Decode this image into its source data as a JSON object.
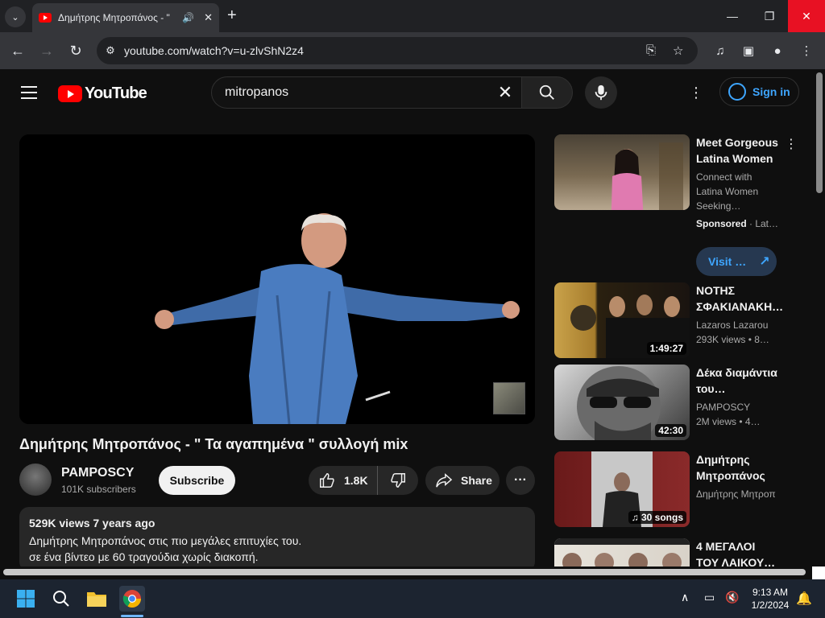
{
  "browser": {
    "tab_title": "Δημήτρης Μητροπάνος - \"",
    "url": "youtube.com/watch?v=u-zlvShN2z4"
  },
  "youtube": {
    "logo_text": "YouTube",
    "search_query": "mitropanos",
    "sign_in_label": "Sign in"
  },
  "video": {
    "title": "Δημήτρης Μητροπάνος - \" Τα αγαπημένα \" συλλογή mix",
    "channel_name": "PAMPOSCY",
    "subscribers": "101K subscribers",
    "subscribe_label": "Subscribe",
    "likes": "1.8K",
    "share_label": "Share",
    "views_and_date": "529K views  7 years ago",
    "description_lines": [
      "Δημήτρης Μητροπάνος στις πιο μεγάλες επιτυχίες του.",
      "σε ένα βίντεο με 60 τραγούδια  χωρίς διακοπή."
    ]
  },
  "sidebar": {
    "ad": {
      "title": "Meet Gorgeous Latina Women",
      "description": "Connect with Latina Women Seeking…",
      "sponsored": "Sponsored",
      "sponsored_suffix": " · Lat…",
      "visit_label": "Visit …"
    },
    "items": [
      {
        "title": "ΝΟΤΗΣ ΣΦΑΚΙΑΝΑΚΗ…",
        "channel": "Lazaros Lazarou",
        "meta": "293K views  • 8…",
        "duration": "1:49:27"
      },
      {
        "title": "Δέκα διαμάντια του…",
        "channel": "PAMPOSCY",
        "meta": "2M views  • 4…",
        "duration": "42:30"
      },
      {
        "title": "Δημήτρης Μητροπάνος",
        "channel": "Δημήτρης Μητροπ",
        "meta": "",
        "duration": "30 songs"
      },
      {
        "title": "4 ΜΕΓΑΛΟΙ ΤΟΥ ΛΑΙΚΟΥ…",
        "channel": "",
        "meta": "",
        "duration": ""
      }
    ]
  },
  "taskbar": {
    "time": "9:13 AM",
    "date": "1/2/2024"
  },
  "colors": {
    "yt_red": "#ff0000",
    "link_blue": "#3ea6ff",
    "close_red": "#e81123"
  }
}
